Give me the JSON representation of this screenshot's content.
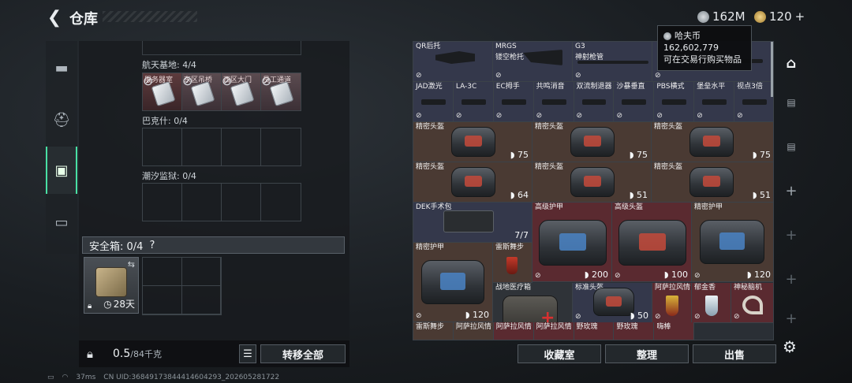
{
  "header": {
    "title": "仓库",
    "currency1": "162M",
    "currency2": "120",
    "currency2_plus": "+",
    "back_icon": "chevron-left-icon"
  },
  "tooltip": {
    "title": "哈夫币",
    "amount": "162,602,779",
    "desc": "可在交易行购买物品"
  },
  "left": {
    "sections": [
      {
        "label": "航天基地: 4/4",
        "slots": [
          "服务器室",
          "东区吊桥",
          "西区大门",
          "员工通道"
        ]
      },
      {
        "label": "巴克什: 0/4"
      },
      {
        "label": "潮汐监狱: 0/4"
      }
    ],
    "safe_label": "安全箱: 0/4",
    "safe_help": "?",
    "safe_time": "28天",
    "weight": "0.5",
    "weight_unit": "/84千克",
    "transfer_all": "转移全部"
  },
  "grid": {
    "row1": [
      {
        "name": "QR后托"
      },
      {
        "name": "MRGS",
        "sub": "镂空枪托"
      },
      {
        "name": "G3",
        "sub": "神射枪管"
      }
    ],
    "row2": [
      "JAD激光",
      "LA-3C",
      "EC拇手",
      "共鸣消音",
      "双流制退器",
      "沙暴垂直",
      "PBS横式",
      "堡垒水平",
      "视点3倍"
    ],
    "row3": [
      {
        "name": "精密头盔",
        "dur": "75"
      },
      {
        "name": "精密头盔",
        "dur": "75"
      },
      {
        "name": "精密头盔",
        "dur": "75"
      }
    ],
    "row4": [
      {
        "name": "精密头盔",
        "dur": "64"
      },
      {
        "name": "精密头盔",
        "dur": "51"
      },
      {
        "name": "精密头盔",
        "dur": "51"
      }
    ],
    "row5": [
      {
        "name": "DEK手术包",
        "dur": "7/7"
      },
      {
        "name": "高级护甲",
        "dur": "200"
      },
      {
        "name": "高级头盔",
        "dur": "100"
      },
      {
        "name": "精密护甲",
        "dur": "120"
      }
    ],
    "row6": [
      {
        "name": "精密护甲",
        "dur": "120"
      },
      {
        "name": "雷斯舞步"
      },
      {
        "name": "战地医疗箱"
      },
      {
        "name": "标准头盔",
        "dur": "50"
      },
      {
        "name": "阿萨拉风情"
      },
      {
        "name": "郁金香"
      },
      {
        "name": "神秘脑机"
      }
    ],
    "row7": [
      "雷斯舞步",
      "阿萨拉风情",
      "阿萨拉风情",
      "阿萨拉风情",
      "野玫瑰",
      "野玫瑰",
      "嗨棒"
    ]
  },
  "footer": {
    "collection": "收藏室",
    "sort": "整理",
    "sell": "出售"
  },
  "status": {
    "ping": "37ms",
    "uid": "CN UID:36849173844414604293_202605281722"
  },
  "colors": {
    "accent": "#49e0a4",
    "brown_slot": "#4a3a33",
    "red_slot": "#5a2a30",
    "blue_slot": "#34384b"
  }
}
